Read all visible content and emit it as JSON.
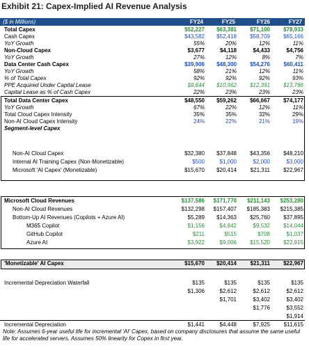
{
  "title": {
    "exhibit": "Exhibit 21:",
    "text": "Capex-Implied AI Revenue Analysis"
  },
  "header": {
    "unit": "($ in Millions)",
    "years": [
      "FY24",
      "FY25",
      "FY26",
      "FY27"
    ]
  },
  "colors": {
    "header_bg": "#1f4e8c",
    "blue": "#1f4fb4",
    "green": "#2e8b3a"
  },
  "section1": [
    {
      "label": "Total Capex",
      "values": [
        "$52,227",
        "$63,381",
        "$71,100",
        "$78,933"
      ],
      "style": "bold-green"
    },
    {
      "label": "Cash Capex",
      "values": [
        "$43,582",
        "$52,418",
        "$58,709",
        "$65,166"
      ],
      "style": "blue"
    },
    {
      "label": "YoY Growth",
      "values": [
        "55%",
        "20%",
        "12%",
        "11%"
      ],
      "style": "italic"
    },
    {
      "label": "Non-Cloud Capex",
      "values": [
        "$3,677",
        "$4,118",
        "$4,433",
        "$4,756"
      ],
      "style": "bold"
    },
    {
      "label": "YoY Growth",
      "values": [
        "27%",
        "12%",
        "8%",
        "7%"
      ],
      "style": "italic"
    },
    {
      "label": "Data Center Cash Capex",
      "values": [
        "$39,906",
        "$48,300",
        "$54,276",
        "$60,411"
      ],
      "style": "bold-blue"
    },
    {
      "label": "YoY Growth",
      "values": [
        "58%",
        "21%",
        "12%",
        "11%"
      ],
      "style": "italic"
    },
    {
      "label": "% of Total Capex",
      "values": [
        "92%",
        "92%",
        "92%",
        "93%"
      ],
      "style": "italic"
    },
    {
      "label": "PPE Acquired Under Capital Lease",
      "values": [
        "$8,644",
        "$10,962",
        "$12,391",
        "$13,766"
      ],
      "style": "italic-green"
    },
    {
      "label": "Capital Lease as % of Cash Capex",
      "values": [
        "22%",
        "23%",
        "23%",
        "23%"
      ],
      "style": "italic"
    }
  ],
  "section2": {
    "rows": [
      {
        "label": "Total Data Center Capex",
        "values": [
          "$48,550",
          "$59,262",
          "$66,667",
          "$74,177"
        ],
        "style": "bold"
      },
      {
        "label": "YoY Growth",
        "values": [
          "67%",
          "22%",
          "12%",
          "11%"
        ],
        "style": "italic"
      },
      {
        "label": "Total Cloud Capex Intensity",
        "values": [
          "35%",
          "35%",
          "32%",
          "29%"
        ],
        "style": "plain"
      },
      {
        "label": "Non-AI Cloud Capex Intensity",
        "values": [
          "24%",
          "22%",
          "21%",
          "19%"
        ],
        "style": "blue"
      },
      {
        "label": "Segment-level Capex",
        "values": [
          "",
          "",
          "",
          ""
        ],
        "style": "bold-italic"
      }
    ],
    "segments": [
      {
        "label": "Non-AI Cloud Capex",
        "values": [
          "$32,380",
          "$37,848",
          "$43,356",
          "$48,210"
        ],
        "style": "plain"
      },
      {
        "label": "Internal AI Training Capex (Non-Monetizable)",
        "values": [
          "$500",
          "$1,000",
          "$2,000",
          "$3,000"
        ],
        "style": "blue"
      },
      {
        "label": "Microsoft 'AI Capex' (Monetizable)",
        "values": [
          "$15,670",
          "$20,414",
          "$21,311",
          "$22,967"
        ],
        "style": "plain"
      }
    ]
  },
  "cloud": {
    "rows": [
      {
        "label": "Microsoft Cloud Revenues",
        "values": [
          "$137,586",
          "$171,770",
          "$211,143",
          "$253,280"
        ],
        "style": "bold-green"
      },
      {
        "label": "Non-AI Cloud Revenues",
        "values": [
          "$132,298",
          "$157,407",
          "$185,383",
          "$215,385"
        ],
        "style": "plain"
      },
      {
        "label": "Bottom-Up AI Revenues (Copilots + Azure AI)",
        "values": [
          "$5,289",
          "$14,363",
          "$25,760",
          "$37,895"
        ],
        "style": "plain"
      },
      {
        "label": "M365 Copilot",
        "values": [
          "$1,156",
          "$4,842",
          "$9,532",
          "$14,044"
        ],
        "style": "green"
      },
      {
        "label": "GitHub Copilot",
        "values": [
          "$211",
          "$515",
          "$708",
          "$1,037"
        ],
        "style": "green"
      },
      {
        "label": "Azure AI",
        "values": [
          "$3,922",
          "$9,006",
          "$15,520",
          "$22,815"
        ],
        "style": "green"
      }
    ]
  },
  "monetizable": {
    "label": "'Monetizable' AI Capex",
    "values": [
      "$15,670",
      "$20,414",
      "$21,311",
      "$22,967"
    ]
  },
  "waterfall": {
    "label": "Incremental Depreciation Waterfall",
    "rows": [
      [
        "$135",
        "$135",
        "$135",
        "$135"
      ],
      [
        "$1,306",
        "$2,612",
        "$2,612",
        "$2,612"
      ],
      [
        "",
        "$1,701",
        "$3,402",
        "$3,402"
      ],
      [
        "",
        "",
        "$1,776",
        "$3,552"
      ],
      [
        "",
        "",
        "",
        "$1,914"
      ]
    ]
  },
  "incremental": {
    "label": "Incremental Depreciation",
    "values": [
      "$1,441",
      "$4,448",
      "$7,925",
      "$11,615"
    ]
  },
  "note": "Note: Assumes 6-year useful life for incremental 'AI' Capex, based on company disclosures that assume the same useful life for accelerated servers. Assumes 50% linearity for Copex in first year."
}
